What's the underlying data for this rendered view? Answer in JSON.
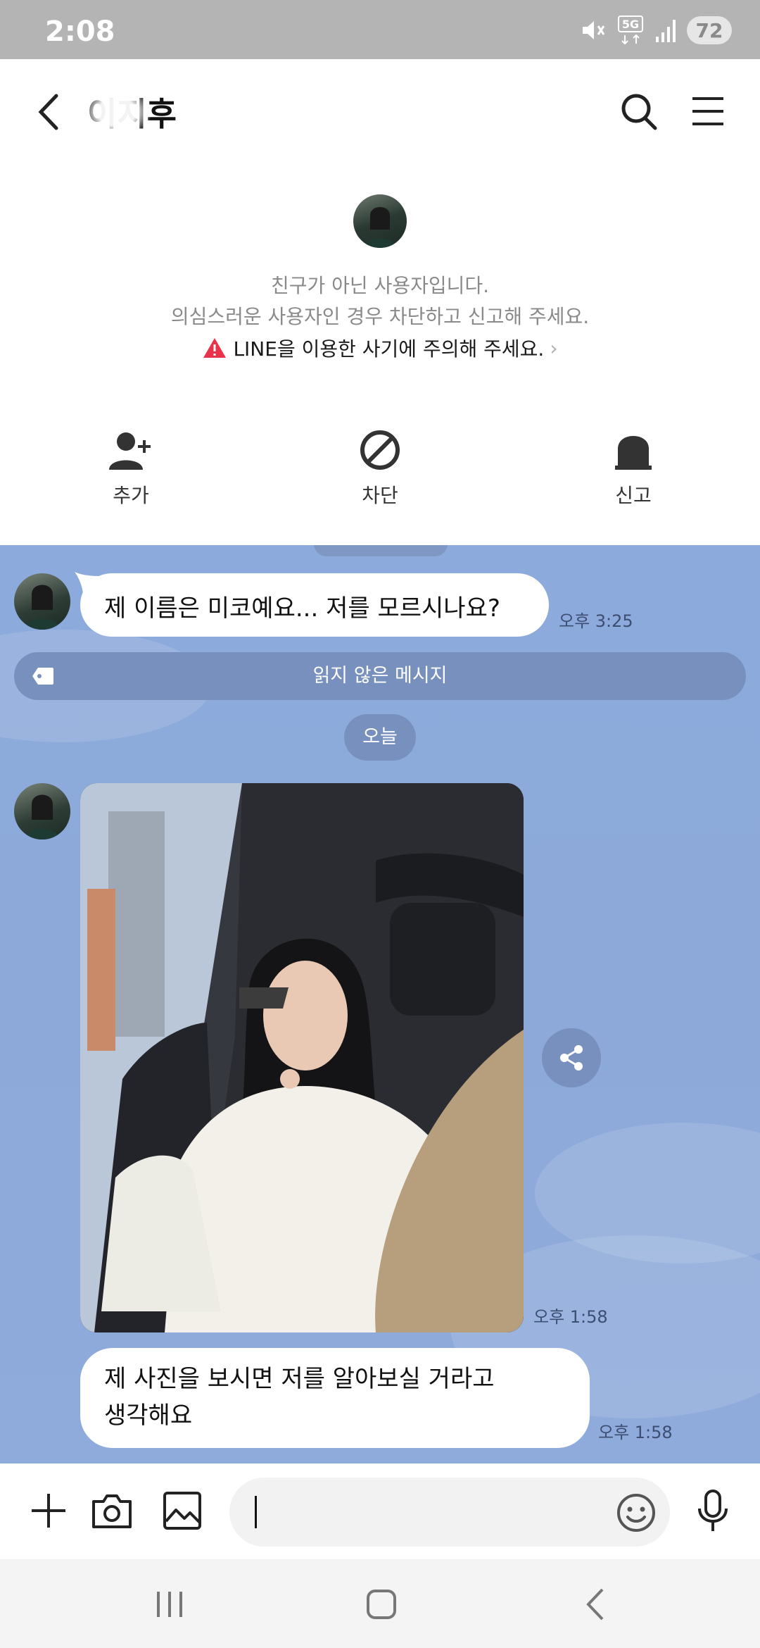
{
  "status_bar": {
    "time": "2:08",
    "network": "5G",
    "battery": "72"
  },
  "header": {
    "chat_title": "이지후",
    "back_icon": "chevron-left-icon",
    "search_icon": "search-icon",
    "menu_icon": "hamburger-menu-icon"
  },
  "notice": {
    "line1": "친구가 아닌 사용자입니다.",
    "line2": "의심스러운 사용자인 경우 차단하고 신고해 주세요.",
    "warning": "LINE을 이용한 사기에 주의해 주세요.",
    "actions": [
      {
        "label": "추가",
        "icon": "add-friend-icon"
      },
      {
        "label": "차단",
        "icon": "block-icon"
      },
      {
        "label": "신고",
        "icon": "report-icon"
      }
    ]
  },
  "chat": {
    "messages": [
      {
        "type": "text",
        "text": "제 이름은 미코예요... 저를 모르시나요?",
        "time": "오후 3:25"
      },
      {
        "type": "image",
        "time": "오후 1:58"
      },
      {
        "type": "text",
        "text": "제 사진을 보시면 저를 알아보실 거라고\n생각해요",
        "time": "오후 1:58"
      }
    ],
    "unread_label": "읽지 않은 메시지",
    "date_label": "오늘"
  },
  "input_bar": {
    "placeholder": "",
    "buttons": [
      "plus-icon",
      "camera-icon",
      "image-icon",
      "emoji-icon",
      "microphone-icon"
    ]
  },
  "colors": {
    "chat_bg": "#8caadb",
    "pill_bg": "#7790bd",
    "warning_red": "#e8334a"
  }
}
